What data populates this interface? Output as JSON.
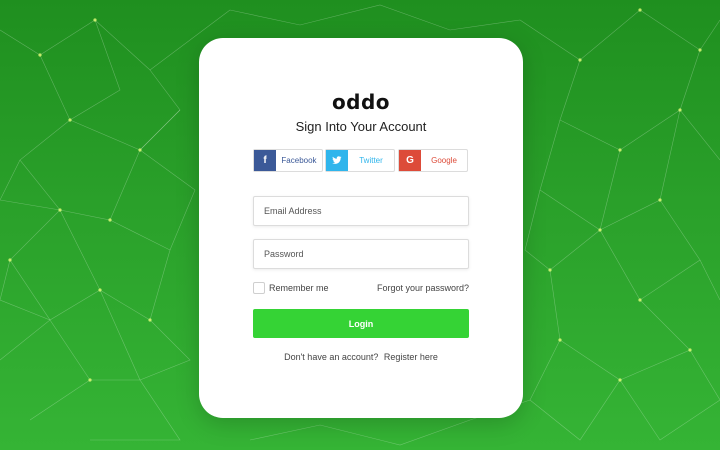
{
  "brand": {
    "logo_text": "oddo"
  },
  "login_card": {
    "title": "Sign Into Your Account",
    "social": {
      "facebook": {
        "icon_glyph": "f",
        "label": "Facebook",
        "icon_color": "#3b5998",
        "text_color": "#3b5998",
        "icon": "facebook-icon"
      },
      "twitter": {
        "icon_glyph": "🐦",
        "label": "Twitter",
        "icon_color": "#2fb5ec",
        "text_color": "#2fb5ec",
        "icon": "twitter-icon"
      },
      "google": {
        "icon_glyph": "G",
        "label": "Google",
        "icon_color": "#dd4b39",
        "text_color": "#dd4b39",
        "icon": "google-icon"
      }
    },
    "email_placeholder": "Email Address",
    "password_placeholder": "Password",
    "remember_label": "Remember me",
    "remember_checked": false,
    "forgot_link": "Forgot your password?",
    "login_button": "Login",
    "signup_prompt": "Don't have an account?",
    "register_link": "Register here"
  },
  "theme": {
    "background": "#2aa02a",
    "button": "#35d335",
    "card": "#ffffff"
  }
}
